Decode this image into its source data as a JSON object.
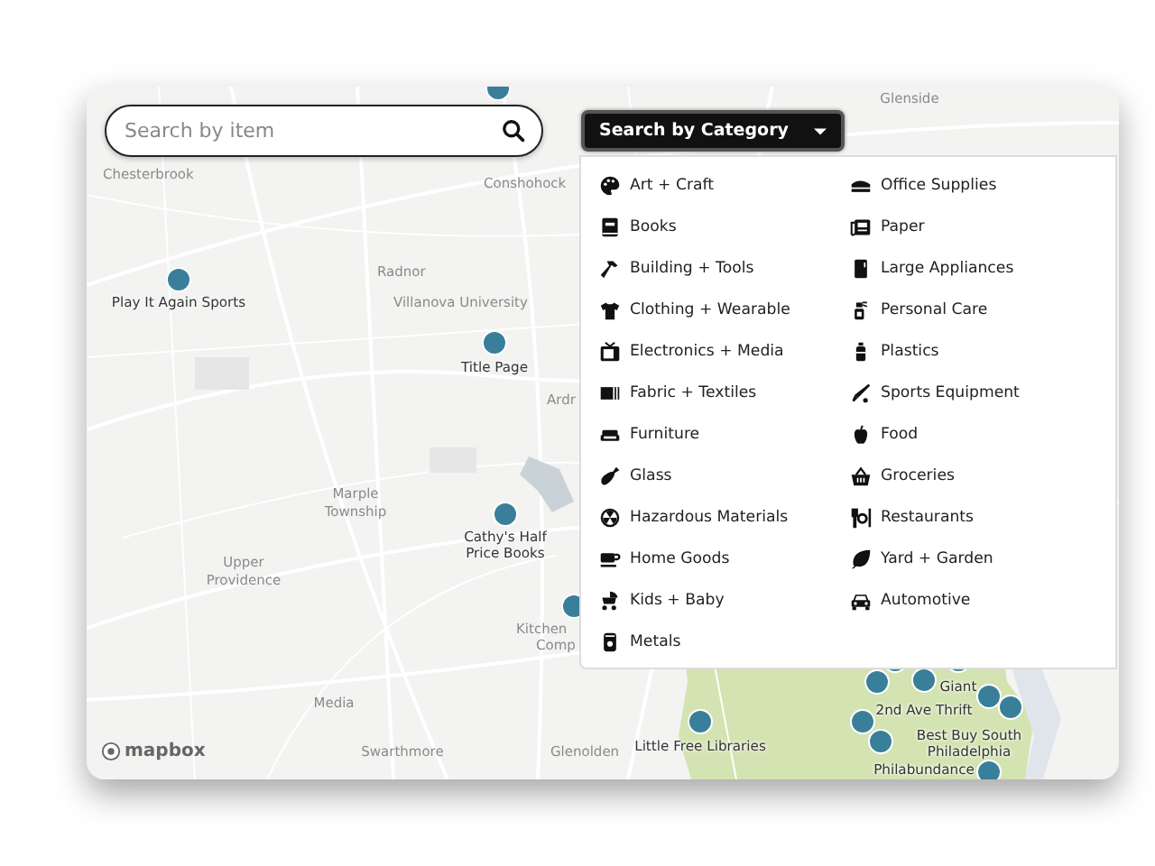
{
  "search": {
    "placeholder": "Search by item"
  },
  "category_button": {
    "label": "Search by Category",
    "expanded": true
  },
  "categories": {
    "column_1": [
      {
        "label": "Art + Craft"
      },
      {
        "label": "Books"
      },
      {
        "label": "Building + Tools"
      },
      {
        "label": "Clothing + Wearable"
      },
      {
        "label": "Electronics + Media"
      },
      {
        "label": "Fabric + Textiles"
      },
      {
        "label": "Furniture"
      },
      {
        "label": "Glass"
      },
      {
        "label": "Hazardous Materials"
      },
      {
        "label": "Home Goods"
      },
      {
        "label": "Kids + Baby"
      },
      {
        "label": "Metals"
      }
    ],
    "column_2": [
      {
        "label": "Office Supplies"
      },
      {
        "label": "Paper"
      },
      {
        "label": "Large Appliances"
      },
      {
        "label": "Personal Care"
      },
      {
        "label": "Plastics"
      },
      {
        "label": "Sports Equipment"
      },
      {
        "label": "Food"
      },
      {
        "label": "Groceries"
      },
      {
        "label": "Restaurants"
      },
      {
        "label": "Yard + Garden"
      },
      {
        "label": "Automotive"
      }
    ]
  },
  "map": {
    "places": [
      "Glenside",
      "Chesterbrook",
      "Conshohock",
      "Radnor",
      "Villanova University",
      "Ardr",
      "Marple Township",
      "Upper Providence",
      "Kitchen",
      "Comp",
      "Media",
      "Swarthmore",
      "Glenolden"
    ],
    "pins": [
      {
        "label": "Play It Again Sports"
      },
      {
        "label": "Title Page"
      },
      {
        "label": "Cathy's Half Price Books"
      },
      {
        "label": "Little Free Libraries"
      },
      {
        "label": "Giant"
      },
      {
        "label": "2nd Ave Thrift"
      },
      {
        "label": "Best Buy South Philadelphia"
      },
      {
        "label": "Philabundance"
      }
    ],
    "attribution": "mapbox"
  }
}
